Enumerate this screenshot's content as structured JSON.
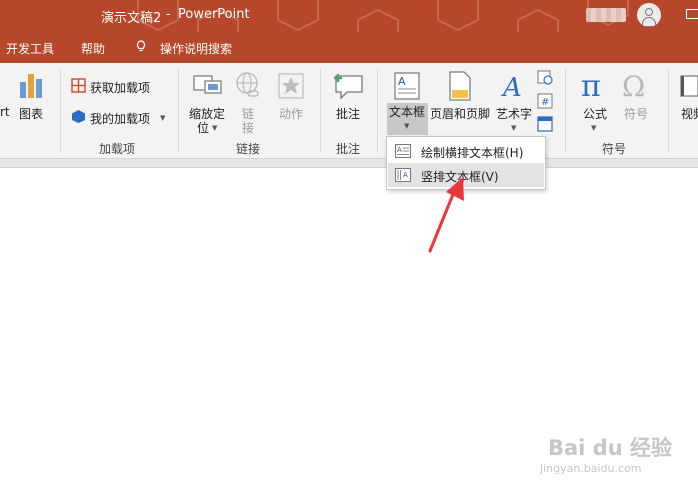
{
  "window": {
    "doc_title": "演示文稿2",
    "sep": "-",
    "app_name": "PowerPoint"
  },
  "tabs": [
    {
      "label": "开发工具"
    },
    {
      "label": "帮助"
    },
    {
      "label": "操作说明搜索"
    }
  ],
  "ribbon": {
    "partial_label": "rt",
    "chart": "图表",
    "addins": {
      "get": "获取加载项",
      "mine": "我的加载项",
      "group": "加载项"
    },
    "links": {
      "zoom1": "缩放定",
      "zoom2": "位",
      "link1": "链",
      "link2": "接",
      "action": "动作",
      "group": "链接"
    },
    "comments": {
      "comment": "批注",
      "group": "批注"
    },
    "text": {
      "textbox": "文本框",
      "headerfooter": "页眉和页脚",
      "wordart": "艺术字"
    },
    "symbols": {
      "equation": "公式",
      "symbol": "符号",
      "group": "符号"
    },
    "media": {
      "video_partial": "视频"
    }
  },
  "dropdown": {
    "items": [
      {
        "label": "绘制横排文本框(H)",
        "state": "normal"
      },
      {
        "label": "竖排文本框(V)",
        "state": "hover"
      }
    ]
  },
  "watermark": {
    "brand": "Bai du 经验",
    "url": "jingyan.baidu.com"
  },
  "colors": {
    "accent": "#b7472a",
    "ribbon_bg": "#f3f3f3",
    "annotation_arrow": "#e8383d"
  }
}
